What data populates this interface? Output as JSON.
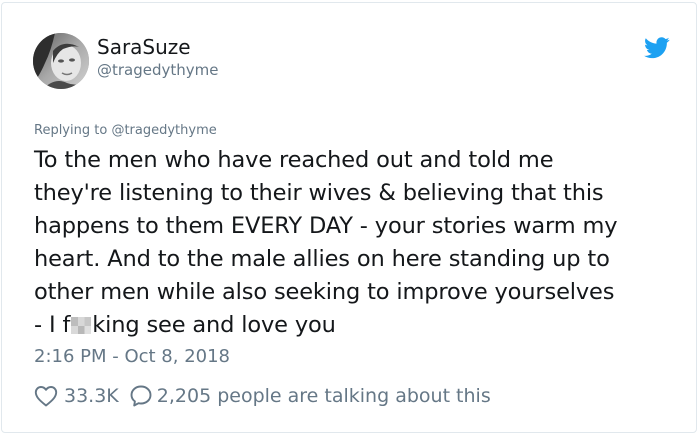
{
  "user": {
    "display_name": "SaraSuze",
    "handle": "@tragedythyme",
    "avatar_icon": "avatar-photo"
  },
  "platform_icon": "twitter-bird-icon",
  "colors": {
    "twitter_blue": "#1da1f2",
    "secondary_text": "#657786",
    "primary_text": "#14171a",
    "border": "#e1e8ed"
  },
  "reply": {
    "prefix": "Replying to",
    "to_handle": "@tragedythyme"
  },
  "tweet": {
    "lines": [
      "To the men who have reached out and told me",
      "they're listening to their wives & believing that this",
      "happens to them EVERY DAY - your stories warm my",
      "heart. And to the male allies on here standing up to",
      "other men while also seeking to improve yourselves"
    ],
    "last_line_before": "- I f",
    "last_line_after": "king see and love you"
  },
  "timestamp": "2:16 PM - Oct 8, 2018",
  "footer": {
    "like_icon": "heart-icon",
    "likes": "33.3K",
    "comment_icon": "speech-bubble-icon",
    "talking": "2,205 people are talking about this"
  }
}
